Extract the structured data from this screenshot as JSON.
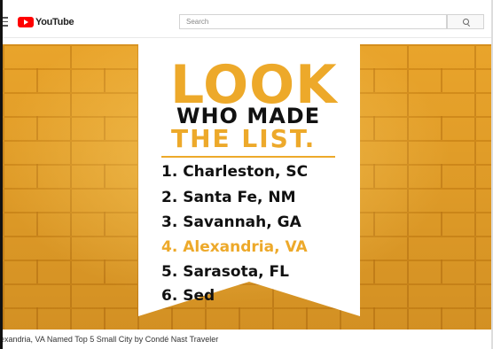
{
  "header": {
    "logo_text": "YouTube",
    "search_placeholder": "Search"
  },
  "video": {
    "headline_line1": "LOOK",
    "headline_line2": "WHO MADE",
    "headline_line3": "THE LIST.",
    "list": [
      {
        "text": "1. Charleston, SC",
        "highlight": false
      },
      {
        "text": "2. Santa Fe, NM",
        "highlight": false
      },
      {
        "text": "3. Savannah, GA",
        "highlight": false
      },
      {
        "text": "4. Alexandria, VA",
        "highlight": true
      },
      {
        "text": "5. Sarasota, FL",
        "highlight": false
      },
      {
        "text": "6. Sed",
        "highlight": false
      }
    ]
  },
  "video_title": "exandria, VA Named Top 5 Small City by Condé Nast Traveler",
  "colors": {
    "accent": "#eda92a",
    "youtube_red": "#ff0000"
  }
}
